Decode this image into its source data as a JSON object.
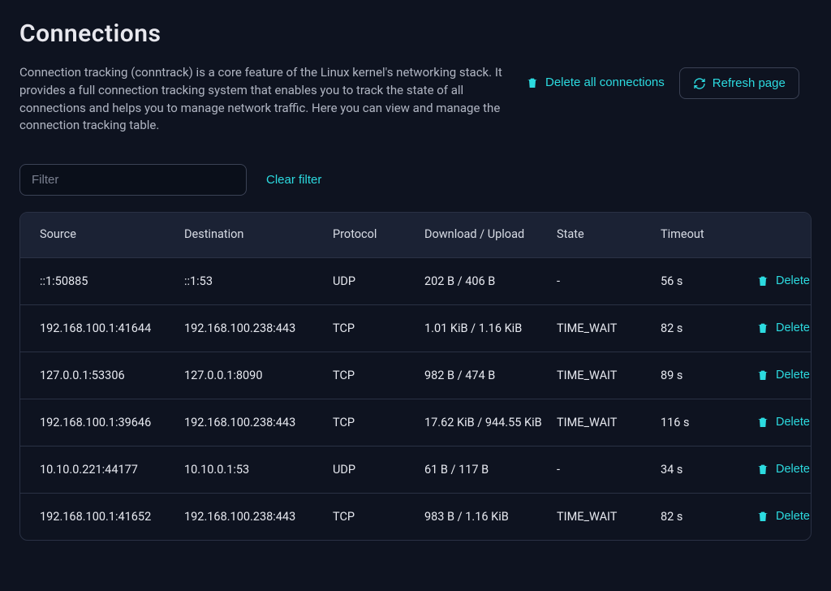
{
  "page": {
    "title": "Connections",
    "description": "Connection tracking (conntrack) is a core feature of the Linux kernel's networking stack. It provides a full connection tracking system that enables you to track the state of all connections and helps you to manage network traffic. Here you can view and manage the connection tracking table."
  },
  "actions": {
    "delete_all": "Delete all connections",
    "refresh": "Refresh page"
  },
  "filter": {
    "placeholder": "Filter",
    "clear": "Clear filter"
  },
  "table": {
    "headers": {
      "source": "Source",
      "destination": "Destination",
      "protocol": "Protocol",
      "du": "Download / Upload",
      "state": "State",
      "timeout": "Timeout"
    },
    "row_action": "Delete",
    "rows": [
      {
        "source": "::1:50885",
        "destination": "::1:53",
        "protocol": "UDP",
        "du": "202 B / 406 B",
        "state": "-",
        "timeout": "56 s"
      },
      {
        "source": "192.168.100.1:41644",
        "destination": "192.168.100.238:443",
        "protocol": "TCP",
        "du": "1.01 KiB / 1.16 KiB",
        "state": "TIME_WAIT",
        "timeout": "82 s"
      },
      {
        "source": "127.0.0.1:53306",
        "destination": "127.0.0.1:8090",
        "protocol": "TCP",
        "du": "982 B / 474 B",
        "state": "TIME_WAIT",
        "timeout": "89 s"
      },
      {
        "source": "192.168.100.1:39646",
        "destination": "192.168.100.238:443",
        "protocol": "TCP",
        "du": "17.62 KiB / 944.55 KiB",
        "state": "TIME_WAIT",
        "timeout": "116 s"
      },
      {
        "source": "10.10.0.221:44177",
        "destination": "10.10.0.1:53",
        "protocol": "UDP",
        "du": "61 B / 117 B",
        "state": "-",
        "timeout": "34 s"
      },
      {
        "source": "192.168.100.1:41652",
        "destination": "192.168.100.238:443",
        "protocol": "TCP",
        "du": "983 B / 1.16 KiB",
        "state": "TIME_WAIT",
        "timeout": "82 s"
      }
    ]
  }
}
